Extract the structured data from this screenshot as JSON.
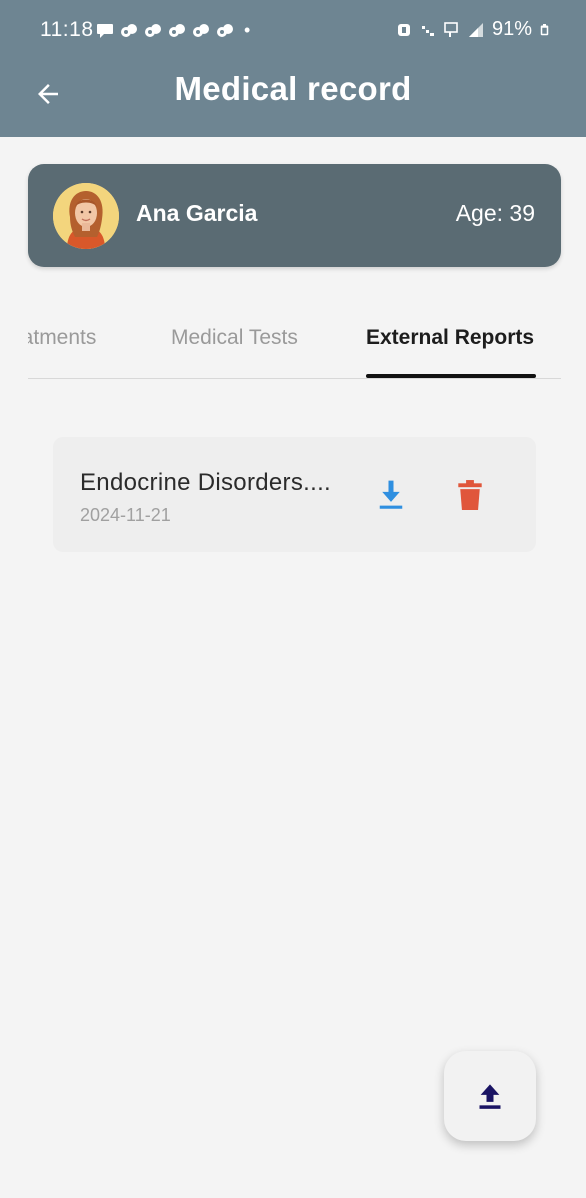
{
  "status_bar": {
    "time": "11:18",
    "battery": "91%",
    "notification_icons": [
      "message-icon",
      "app-notification-icon",
      "app-notification-icon",
      "app-notification-icon",
      "app-notification-icon",
      "app-notification-icon"
    ],
    "dot": "•"
  },
  "header": {
    "title": "Medical record",
    "back_icon": "arrow-left-icon"
  },
  "patient": {
    "name": "Ana Garcia",
    "age_label": "Age: 39",
    "avatar_icon": "avatar"
  },
  "tabs": [
    {
      "label": "eatments",
      "active": false
    },
    {
      "label": "Medical Tests",
      "active": false
    },
    {
      "label": "External Reports",
      "active": true
    }
  ],
  "reports": [
    {
      "title": "Endocrine Disorders....",
      "date": "2024-11-21",
      "download_icon": "download-icon",
      "delete_icon": "trash-icon"
    }
  ],
  "fab": {
    "icon": "upload-icon"
  },
  "colors": {
    "appbar": "#6e8592",
    "patient_card": "#5a6b73",
    "download": "#2f8fe0",
    "delete": "#e0563b",
    "fab_icon": "#1a1464"
  }
}
